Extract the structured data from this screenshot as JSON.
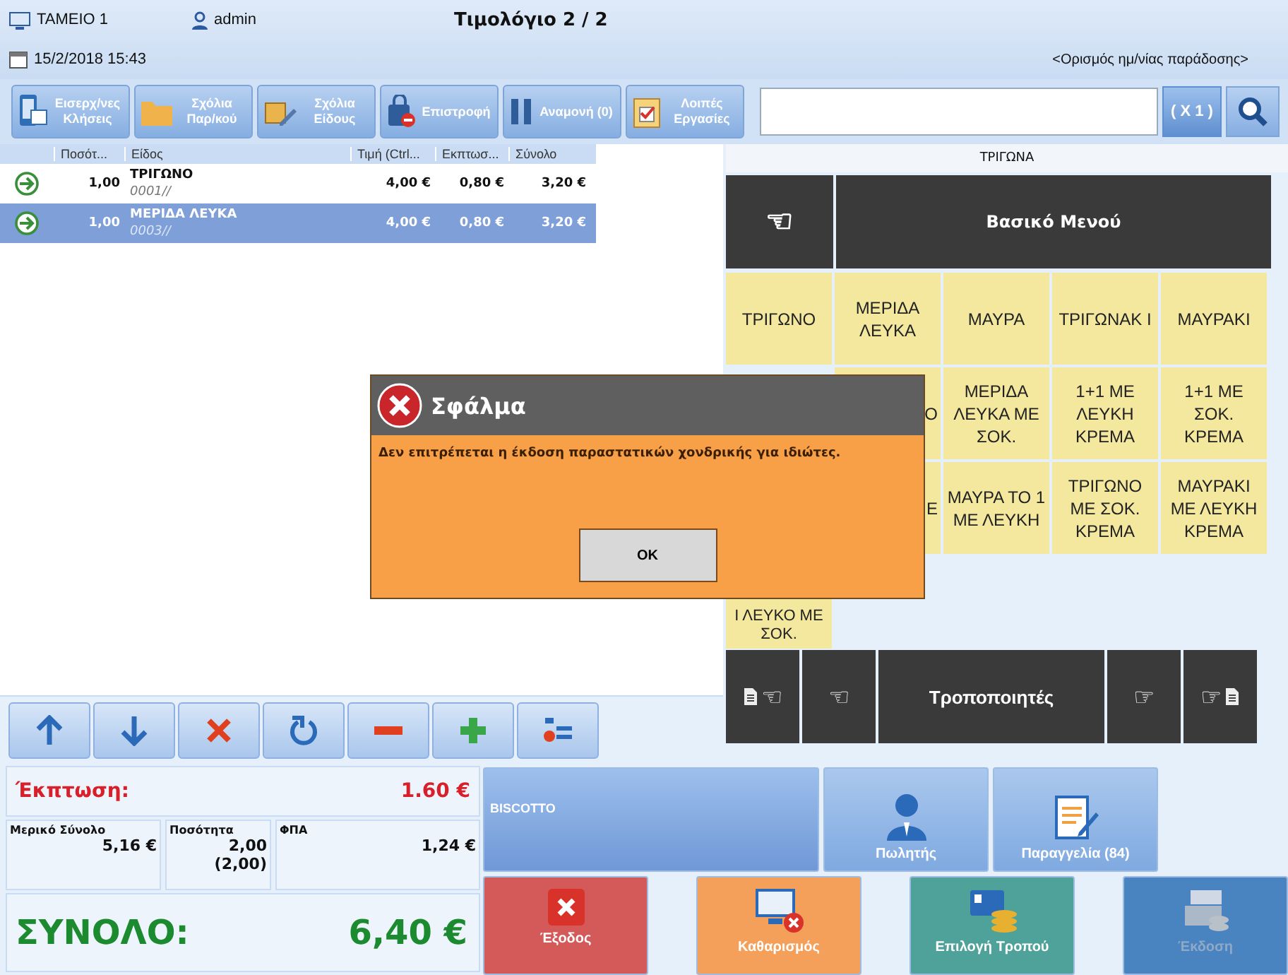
{
  "header": {
    "register": "ΤΑΜΕΙΟ 1",
    "user": "admin",
    "title": "Τιμολόγιο  2 / 2",
    "date": "15/2/2018 15:43",
    "delivery_link": "<Ορισμός ημ/νίας παράδοσης>"
  },
  "toolbar": {
    "buttons": [
      "Εισερχ/νες Κλήσεις",
      "Σχόλια Παρ/κού",
      "Σχόλια Είδους",
      "Επιστροφή",
      "Αναμονή (0)",
      "Λοιπές Εργασίες"
    ],
    "multiplier": "( X 1 )"
  },
  "order_table": {
    "columns": [
      "Ποσότ...",
      "Είδος",
      "Τιμή (Ctrl...",
      "Εκπτωσ...",
      "Σύνολο"
    ],
    "rows": [
      {
        "qty": "1,00",
        "item": "ΤΡΙΓΩΝΟ",
        "code": "0001//",
        "price": "4,00 €",
        "discount": "0,80 €",
        "total": "3,20 €",
        "selected": false
      },
      {
        "qty": "1,00",
        "item": "ΜΕΡΙΔΑ ΛΕΥΚΑ",
        "code": "0003//",
        "price": "4,00 €",
        "discount": "0,80 €",
        "total": "3,20 €",
        "selected": true
      }
    ]
  },
  "category": {
    "title": "ΤΡΙΓΩΝΑ",
    "back": "☜",
    "menu_title": "Βασικό Μενού",
    "rows": [
      {
        "cells": [
          {
            "label": "ΤΡΙΓΩΝΟ",
            "kind": "item"
          },
          {
            "label": "ΜΕΡΙΔΑ ΛΕΥΚΑ",
            "kind": "item"
          },
          {
            "label": "ΜΑΥΡΑ",
            "kind": "item"
          },
          {
            "label": "ΤΡΙΓΩΝΑΚ Ι",
            "kind": "item"
          },
          {
            "label": "ΜΑΥΡΑΚΙ",
            "kind": "item"
          }
        ]
      },
      {
        "cells": [
          {
            "kind": "hidden"
          },
          {
            "label": "Ο",
            "kind": "cut_right"
          },
          {
            "label": "ΜΕΡΙΔΑ ΛΕΥΚΑ ΜΕ ΣΟΚ.",
            "kind": "item"
          },
          {
            "label": "1+1  ΜΕ ΛΕΥΚΗ ΚΡΕΜΑ",
            "kind": "item"
          },
          {
            "label": "1+1 ΜΕ ΣΟΚ. ΚΡΕΜΑ",
            "kind": "item"
          }
        ]
      },
      {
        "cells": [
          {
            "kind": "hidden"
          },
          {
            "label": "Ε",
            "kind": "cut_right"
          },
          {
            "label": "ΜΑΥΡΑ ΤΟ 1 ΜΕ ΛΕΥΚΗ",
            "kind": "item"
          },
          {
            "label": "ΤΡΙΓΩΝΟ ΜΕ ΣΟΚ. ΚΡΕΜΑ",
            "kind": "item"
          },
          {
            "label": "ΜΑΥΡΑΚΙ ΜΕ ΛΕΥΚΗ ΚΡΕΜΑ",
            "kind": "item"
          }
        ]
      },
      {
        "cells": [
          {
            "label": "Ι ΛΕΥΚΟ ΜΕ ΣΟΚ.",
            "kind": "cut_top"
          }
        ]
      }
    ]
  },
  "modifiers": [
    {
      "kind": "doc_prev",
      "glyph": "☜"
    },
    {
      "kind": "prev",
      "glyph": "☜"
    },
    {
      "kind": "title",
      "glyph": "Τροποποιητές"
    },
    {
      "kind": "next",
      "glyph": "☞"
    },
    {
      "kind": "doc_next",
      "glyph": "☞"
    }
  ],
  "totals": {
    "discount_label": "Έκπτωση:",
    "discount": "1.60 €",
    "subtotal_label": "Μερικό Σύνολο",
    "subtotal": "5,16 €",
    "qty_label": "Ποσότητα",
    "qty": "2,00",
    "qty_paren": "(2,00)",
    "vat_label": "ΦΠΑ",
    "vat": "1,24 €",
    "total_label": "ΣΥΝΟΛΟ:",
    "total": "6,40 €"
  },
  "actions": [
    {
      "label": "BISCOTTO",
      "kind": "wide",
      "disabled": false
    },
    {
      "label": "Πωλητής",
      "kind": "seller",
      "disabled": false
    },
    {
      "label": "Παραγγελία (84)",
      "kind": "order",
      "disabled": false
    },
    {
      "label": "Έξοδος",
      "kind": "exit",
      "disabled": false
    },
    {
      "label": "Καθαρισμός",
      "kind": "clear",
      "disabled": false
    },
    {
      "label": "Επιλογή Τροπού",
      "kind": "payment",
      "disabled": false
    },
    {
      "label": "Έκδοση",
      "kind": "issue",
      "disabled": true
    }
  ],
  "dialog": {
    "title": "Σφάλμα",
    "message": "Δεν επιτρέπεται η έκδοση παραστατικών χονδρικής για ιδιώτες.",
    "button": "OK"
  }
}
